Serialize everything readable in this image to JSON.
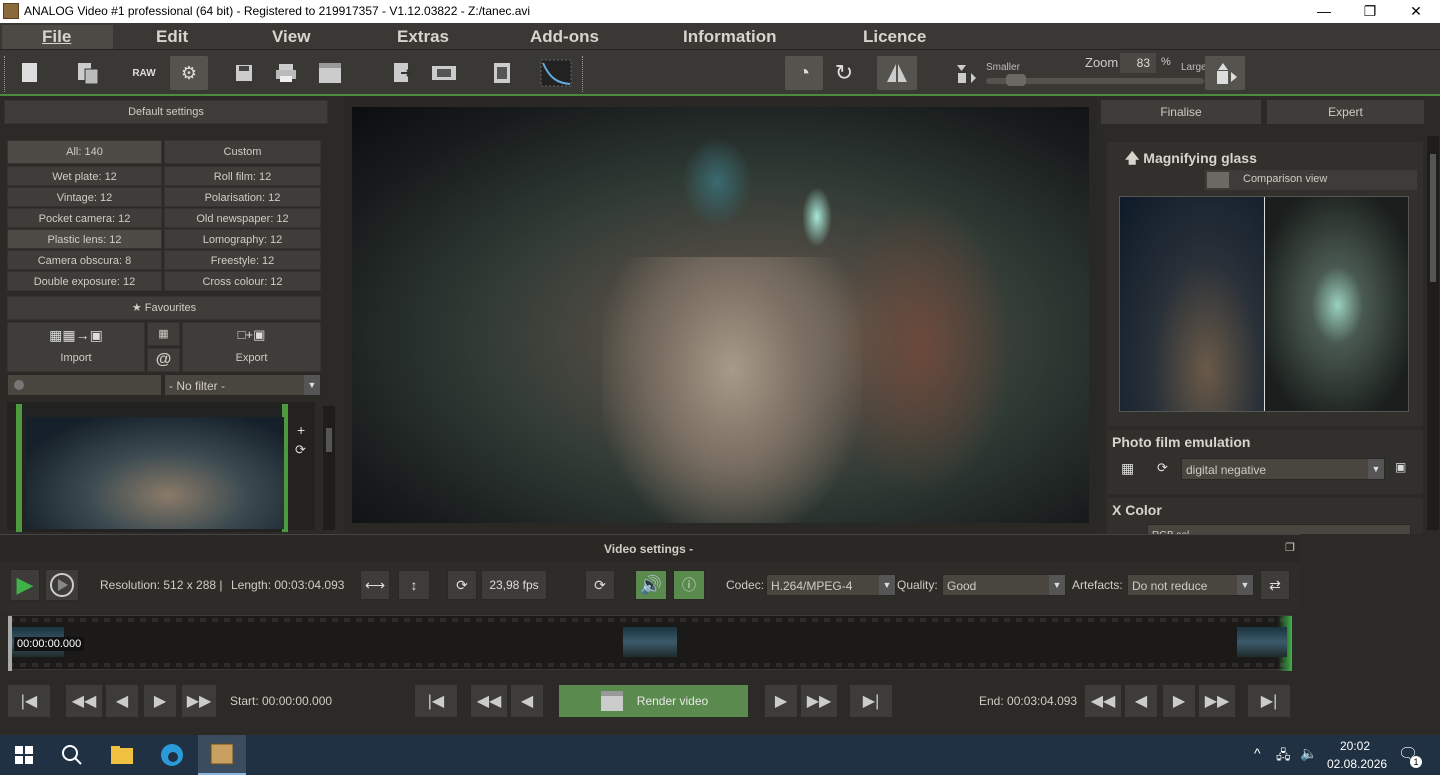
{
  "window": {
    "title": "ANALOG Video #1 professional (64 bit) - Registered to 219917357 - V1.12.03822 - Z:/tanec.avi",
    "minimize": "—",
    "restore": "❐",
    "close": "✕"
  },
  "menu": [
    "File",
    "Edit",
    "View",
    "Extras",
    "Add-ons",
    "Information",
    "Licence"
  ],
  "zoom": {
    "label": "Zoom",
    "value": "83",
    "unit": "%",
    "smaller": "Smaller",
    "larger": "Larger",
    "level": 0.1
  },
  "left": {
    "default_settings": "Default settings",
    "presets": [
      [
        "All: 140",
        "Custom"
      ],
      [
        "Wet plate: 12",
        "Roll film: 12"
      ],
      [
        "Vintage: 12",
        "Polarisation: 12"
      ],
      [
        "Pocket camera: 12",
        "Old newspaper: 12"
      ],
      [
        "Plastic lens: 12",
        "Lomography: 12"
      ],
      [
        "Camera obscura: 8",
        "Freestyle: 12"
      ],
      [
        "Double exposure: 12",
        "Cross colour: 12"
      ]
    ],
    "favourites": "Favourites",
    "import": "Import",
    "export": "Export",
    "at": "@",
    "filter": "- No filter -"
  },
  "right": {
    "tab_finalise": "Finalise",
    "tab_expert": "Expert",
    "magnifying_glass": "Magnifying glass",
    "comparison_view": "Comparison view",
    "photo_film_emulation": "Photo film emulation",
    "film_preset": "digital negative",
    "x_color": "X Color",
    "x_color_partial": "RGB sel..."
  },
  "video_settings": {
    "title": "Video settings -",
    "resolution": "Resolution: 512 x 288 |",
    "length": "Length: 00:03:04.093",
    "fps": "23,98 fps",
    "codec_label": "Codec:",
    "codec": "H.264/MPEG-4",
    "quality_label": "Quality:",
    "quality": "Good",
    "artefacts_label": "Artefacts:",
    "artefacts": "Do not reduce"
  },
  "timeline": {
    "timecode": "00:00:00.000"
  },
  "transport": {
    "start": "Start: 00:00:00.000",
    "end": "End: 00:03:04.093",
    "render": "Render video"
  },
  "taskbar": {
    "time": "20:02",
    "date": "02.08.2026",
    "notif": "1"
  },
  "colors": {
    "accent_green": "#4d8a3e",
    "render_green": "#5a8a4e",
    "panel": "#2c2a26"
  }
}
